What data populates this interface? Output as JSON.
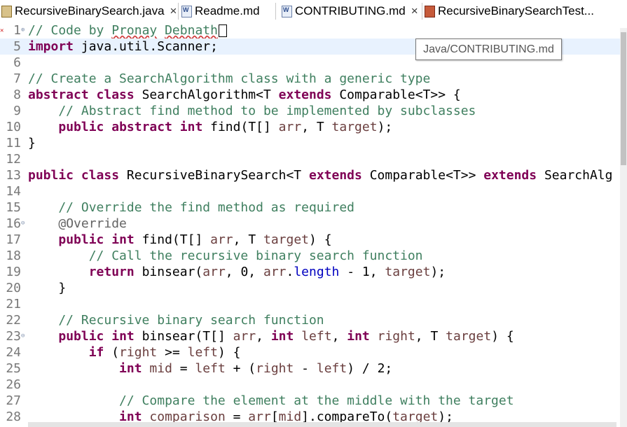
{
  "tabs": [
    {
      "label": "RecursiveBinarySearch.java",
      "icon": "java-file-icon",
      "close": "×"
    },
    {
      "label": "Readme.md",
      "icon": "word-file-icon",
      "close": ""
    },
    {
      "label": "CONTRIBUTING.md",
      "icon": "word-file-icon",
      "close": "×"
    },
    {
      "label": "RecursiveBinarySearchTest...",
      "icon": "java-test-file-icon",
      "close": ""
    }
  ],
  "tooltip": "Java/CONTRIBUTING.md",
  "colors": {
    "keyword": "#7f0055",
    "comment": "#3f7f5f",
    "annotation": "#646464",
    "field": "#0000c0",
    "variable": "#6a3e3e",
    "current_line": "#e8f2fe"
  },
  "editor": {
    "lines": [
      {
        "n": "1",
        "fold": "⊕",
        "parts": [
          {
            "t": "// Code by ",
            "c": "c"
          },
          {
            "t": "Pronay",
            "c": "c squig"
          },
          {
            "t": " ",
            "c": "c"
          },
          {
            "t": "Debnath",
            "c": "c squig"
          }
        ]
      },
      {
        "n": "5",
        "fold": "",
        "parts": [
          {
            "t": "import",
            "c": "k"
          },
          {
            "t": " java.util.Scanner;",
            "c": ""
          }
        ]
      },
      {
        "n": "6",
        "fold": "",
        "parts": []
      },
      {
        "n": "7",
        "fold": "",
        "parts": [
          {
            "t": "// Create a SearchAlgorithm class with a generic type",
            "c": "c"
          }
        ]
      },
      {
        "n": "8",
        "fold": "",
        "parts": [
          {
            "t": "abstract",
            "c": "k"
          },
          {
            "t": " ",
            "c": ""
          },
          {
            "t": "class",
            "c": "k"
          },
          {
            "t": " SearchAlgorithm<T ",
            "c": ""
          },
          {
            "t": "extends",
            "c": "k"
          },
          {
            "t": " Comparable<T>> {",
            "c": ""
          }
        ]
      },
      {
        "n": "9",
        "fold": "",
        "parts": [
          {
            "t": "    // Abstract find method to be implemented by subclasses",
            "c": "c"
          }
        ]
      },
      {
        "n": "10",
        "fold": "",
        "parts": [
          {
            "t": "    ",
            "c": ""
          },
          {
            "t": "public",
            "c": "k"
          },
          {
            "t": " ",
            "c": ""
          },
          {
            "t": "abstract",
            "c": "k"
          },
          {
            "t": " ",
            "c": ""
          },
          {
            "t": "int",
            "c": "k"
          },
          {
            "t": " find(T[] ",
            "c": ""
          },
          {
            "t": "arr",
            "c": "v"
          },
          {
            "t": ", T ",
            "c": ""
          },
          {
            "t": "target",
            "c": "v"
          },
          {
            "t": ");",
            "c": ""
          }
        ]
      },
      {
        "n": "11",
        "fold": "",
        "parts": [
          {
            "t": "}",
            "c": ""
          }
        ]
      },
      {
        "n": "12",
        "fold": "",
        "parts": []
      },
      {
        "n": "13",
        "fold": "",
        "parts": [
          {
            "t": "public",
            "c": "k"
          },
          {
            "t": " ",
            "c": ""
          },
          {
            "t": "class",
            "c": "k"
          },
          {
            "t": " RecursiveBinarySearch<T ",
            "c": ""
          },
          {
            "t": "extends",
            "c": "k"
          },
          {
            "t": " Comparable<T>> ",
            "c": ""
          },
          {
            "t": "extends",
            "c": "k"
          },
          {
            "t": " SearchAlg",
            "c": ""
          }
        ]
      },
      {
        "n": "14",
        "fold": "",
        "parts": []
      },
      {
        "n": "15",
        "fold": "",
        "parts": [
          {
            "t": "    // Override the find method as required",
            "c": "c"
          }
        ]
      },
      {
        "n": "16",
        "fold": "⊖",
        "parts": [
          {
            "t": "    ",
            "c": ""
          },
          {
            "t": "@Override",
            "c": "a"
          }
        ]
      },
      {
        "n": "17",
        "fold": "",
        "parts": [
          {
            "t": "    ",
            "c": ""
          },
          {
            "t": "public",
            "c": "k"
          },
          {
            "t": " ",
            "c": ""
          },
          {
            "t": "int",
            "c": "k"
          },
          {
            "t": " find(T[] ",
            "c": ""
          },
          {
            "t": "arr",
            "c": "v"
          },
          {
            "t": ", T ",
            "c": ""
          },
          {
            "t": "target",
            "c": "v"
          },
          {
            "t": ") {",
            "c": ""
          }
        ]
      },
      {
        "n": "18",
        "fold": "",
        "parts": [
          {
            "t": "        // Call the recursive binary search function",
            "c": "c"
          }
        ]
      },
      {
        "n": "19",
        "fold": "",
        "parts": [
          {
            "t": "        ",
            "c": ""
          },
          {
            "t": "return",
            "c": "k"
          },
          {
            "t": " binsear(",
            "c": ""
          },
          {
            "t": "arr",
            "c": "v"
          },
          {
            "t": ", 0, ",
            "c": ""
          },
          {
            "t": "arr",
            "c": "v"
          },
          {
            "t": ".",
            "c": ""
          },
          {
            "t": "length",
            "c": "f"
          },
          {
            "t": " - 1, ",
            "c": ""
          },
          {
            "t": "target",
            "c": "v"
          },
          {
            "t": ");",
            "c": ""
          }
        ]
      },
      {
        "n": "20",
        "fold": "",
        "parts": [
          {
            "t": "    }",
            "c": ""
          }
        ]
      },
      {
        "n": "21",
        "fold": "",
        "parts": []
      },
      {
        "n": "22",
        "fold": "",
        "parts": [
          {
            "t": "    // Recursive binary search function",
            "c": "c"
          }
        ]
      },
      {
        "n": "23",
        "fold": "⊖",
        "parts": [
          {
            "t": "    ",
            "c": ""
          },
          {
            "t": "public",
            "c": "k"
          },
          {
            "t": " ",
            "c": ""
          },
          {
            "t": "int",
            "c": "k"
          },
          {
            "t": " binsear(T[] ",
            "c": ""
          },
          {
            "t": "arr",
            "c": "v"
          },
          {
            "t": ", ",
            "c": ""
          },
          {
            "t": "int",
            "c": "k"
          },
          {
            "t": " ",
            "c": ""
          },
          {
            "t": "left",
            "c": "v"
          },
          {
            "t": ", ",
            "c": ""
          },
          {
            "t": "int",
            "c": "k"
          },
          {
            "t": " ",
            "c": ""
          },
          {
            "t": "right",
            "c": "v"
          },
          {
            "t": ", T ",
            "c": ""
          },
          {
            "t": "target",
            "c": "v"
          },
          {
            "t": ") {",
            "c": ""
          }
        ]
      },
      {
        "n": "24",
        "fold": "",
        "parts": [
          {
            "t": "        ",
            "c": ""
          },
          {
            "t": "if",
            "c": "k"
          },
          {
            "t": " (",
            "c": ""
          },
          {
            "t": "right",
            "c": "v"
          },
          {
            "t": " >= ",
            "c": ""
          },
          {
            "t": "left",
            "c": "v"
          },
          {
            "t": ") {",
            "c": ""
          }
        ]
      },
      {
        "n": "25",
        "fold": "",
        "parts": [
          {
            "t": "            ",
            "c": ""
          },
          {
            "t": "int",
            "c": "k"
          },
          {
            "t": " ",
            "c": ""
          },
          {
            "t": "mid",
            "c": "v"
          },
          {
            "t": " = ",
            "c": ""
          },
          {
            "t": "left",
            "c": "v"
          },
          {
            "t": " + (",
            "c": ""
          },
          {
            "t": "right",
            "c": "v"
          },
          {
            "t": " - ",
            "c": ""
          },
          {
            "t": "left",
            "c": "v"
          },
          {
            "t": ") / 2;",
            "c": ""
          }
        ]
      },
      {
        "n": "26",
        "fold": "",
        "parts": []
      },
      {
        "n": "27",
        "fold": "",
        "parts": [
          {
            "t": "            // Compare the element at the middle with the target",
            "c": "c"
          }
        ]
      },
      {
        "n": "28",
        "fold": "",
        "parts": [
          {
            "t": "            ",
            "c": ""
          },
          {
            "t": "int",
            "c": "k"
          },
          {
            "t": " ",
            "c": ""
          },
          {
            "t": "comparison",
            "c": "v"
          },
          {
            "t": " = ",
            "c": ""
          },
          {
            "t": "arr",
            "c": "v"
          },
          {
            "t": "[",
            "c": ""
          },
          {
            "t": "mid",
            "c": "v"
          },
          {
            "t": "].compareTo(",
            "c": ""
          },
          {
            "t": "target",
            "c": "v"
          },
          {
            "t": ");",
            "c": ""
          }
        ]
      }
    ]
  }
}
